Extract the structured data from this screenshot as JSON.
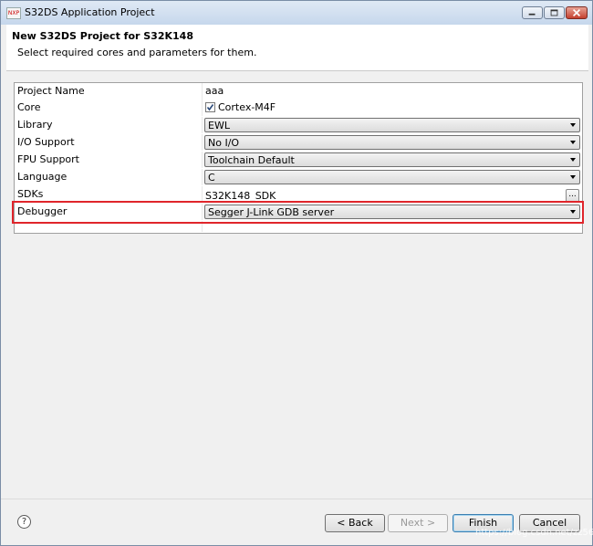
{
  "window": {
    "title": "S32DS Application Project",
    "icon_text": "NXP"
  },
  "header": {
    "title": "New S32DS Project for S32K148",
    "description": "Select required cores and parameters for them."
  },
  "table": {
    "project_name": {
      "label": "Project Name",
      "value": "aaa"
    },
    "core": {
      "label": "Core",
      "value": "Cortex-M4F",
      "checked": true
    },
    "library": {
      "label": "Library",
      "value": "EWL"
    },
    "io_support": {
      "label": "I/O Support",
      "value": "No I/O"
    },
    "fpu_support": {
      "label": "FPU Support",
      "value": "Toolchain Default"
    },
    "language": {
      "label": "Language",
      "value": "C"
    },
    "sdks": {
      "label": "SDKs",
      "value": "S32K148_SDK",
      "browse_label": "..."
    },
    "debugger": {
      "label": "Debugger",
      "value": "Segger J-Link GDB server"
    }
  },
  "highlight_color": "#e0252b",
  "footer": {
    "help_label": "?",
    "back_label": "< Back",
    "next_label": "Next >",
    "finish_label": "Finish",
    "cancel_label": "Cancel",
    "watermark": "https://blog.csdn.net/zz56z56"
  }
}
